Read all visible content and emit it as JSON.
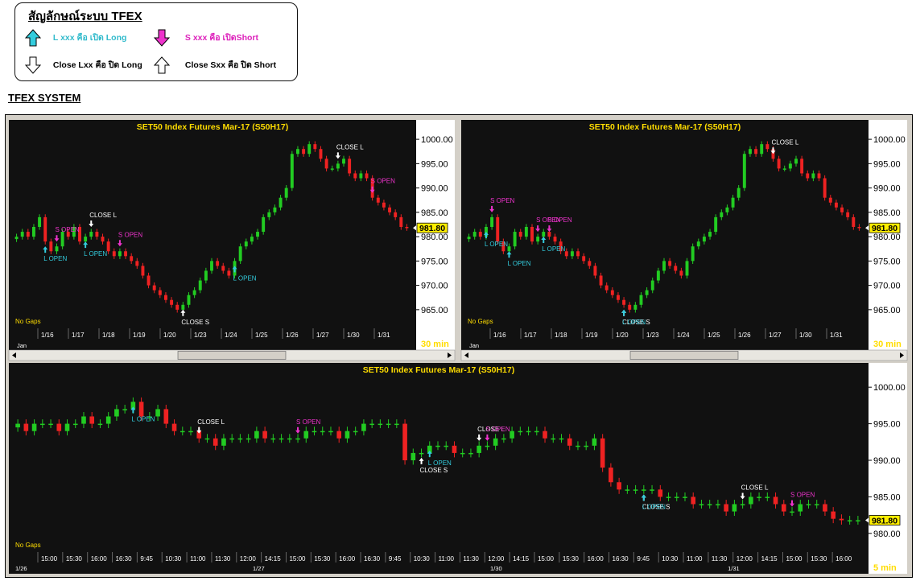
{
  "legend": {
    "title": "สัญลักษณ์ระบบ TFEX",
    "items": [
      {
        "label": "L xxx คือ เปิด Long",
        "icon": "arrow-up-filled-icon",
        "color": "#33ccdd"
      },
      {
        "label": "S xxx คือ เปิดShort",
        "icon": "arrow-down-filled-icon",
        "color": "#ee33cc"
      },
      {
        "label": "Close Lxx คือ ปิด Long",
        "icon": "arrow-down-outline-icon",
        "color": "#000000"
      },
      {
        "label": "Close Sxx คือ ปิด Short",
        "icon": "arrow-up-outline-icon",
        "color": "#000000"
      }
    ]
  },
  "section_title": "TFEX SYSTEM",
  "colors": {
    "up": "#22cc22",
    "down": "#ee2222",
    "long": "#33ccdd",
    "short": "#ee33cc",
    "close": "#ffffff",
    "title": "#ffdd00",
    "price_box": "#ffee00"
  },
  "chart_data": [
    {
      "type": "candlestick",
      "title": "SET50  Index  Futures  Mar-17  (S50H17)",
      "interval": "30  min",
      "note": "No Gaps",
      "last_price": "981.80",
      "ylim": [
        962,
        1002
      ],
      "yticks": [
        "1000.00",
        "995.00",
        "990.00",
        "985.00",
        "980.00",
        "975.00",
        "970.00",
        "965.00"
      ],
      "x_labels": [
        "1/16",
        "1/17",
        "1/18",
        "1/19",
        "1/20",
        "1/23",
        "1/24",
        "1/25",
        "1/26",
        "1/27",
        "1/30",
        "1/31"
      ],
      "period_label": "Jan",
      "closes": [
        980,
        981,
        980,
        982,
        984,
        979,
        977,
        978,
        981,
        980,
        982,
        979,
        980,
        981,
        980,
        979,
        977,
        976,
        977,
        976,
        975,
        974,
        972,
        970,
        969,
        968,
        967,
        966,
        965,
        966,
        968,
        969,
        971,
        973,
        975,
        974,
        973,
        972,
        975,
        978,
        979,
        980,
        981,
        984,
        985,
        986,
        988,
        990,
        997,
        998,
        997,
        999,
        998,
        996,
        994,
        994,
        995,
        996,
        993,
        992,
        993,
        992,
        988,
        987,
        986,
        985,
        984,
        982,
        981.8
      ],
      "markers": [
        {
          "i": 5,
          "kind": "long",
          "text": "L  OPEN"
        },
        {
          "i": 7,
          "kind": "short",
          "text": "S  OPEN"
        },
        {
          "i": 12,
          "kind": "long",
          "text": "L  OPEN"
        },
        {
          "i": 13,
          "kind": "close_long",
          "text": "CLOSE  L"
        },
        {
          "i": 18,
          "kind": "short",
          "text": "S  OPEN"
        },
        {
          "i": 29,
          "kind": "close_short",
          "text": "CLOSE  S"
        },
        {
          "i": 38,
          "kind": "long",
          "text": "L  OPEN"
        },
        {
          "i": 56,
          "kind": "close_long",
          "text": "CLOSE  L"
        },
        {
          "i": 62,
          "kind": "short",
          "text": "S  OPEN"
        }
      ]
    },
    {
      "type": "candlestick",
      "title": "SET50  Index  Futures  Mar-17  (S50H17)",
      "interval": "30  min",
      "note": "No Gaps",
      "last_price": "981.80",
      "ylim": [
        962,
        1002
      ],
      "yticks": [
        "1000.00",
        "995.00",
        "990.00",
        "985.00",
        "980.00",
        "975.00",
        "970.00",
        "965.00"
      ],
      "x_labels": [
        "1/16",
        "1/17",
        "1/18",
        "1/19",
        "1/20",
        "1/23",
        "1/24",
        "1/25",
        "1/26",
        "1/27",
        "1/30",
        "1/31"
      ],
      "period_label": "Jan",
      "closes": [
        980,
        981,
        980,
        982,
        984,
        979,
        977,
        978,
        981,
        980,
        982,
        979,
        980,
        981,
        980,
        979,
        977,
        976,
        977,
        976,
        975,
        974,
        972,
        970,
        969,
        968,
        967,
        966,
        965,
        966,
        968,
        969,
        971,
        973,
        975,
        974,
        973,
        972,
        975,
        978,
        979,
        980,
        981,
        984,
        985,
        986,
        988,
        990,
        997,
        998,
        997,
        999,
        998,
        996,
        994,
        994,
        995,
        996,
        993,
        992,
        993,
        992,
        988,
        987,
        986,
        985,
        984,
        982,
        981.8
      ],
      "markers": [
        {
          "i": 4,
          "kind": "short",
          "text": "S  OPEN"
        },
        {
          "i": 3,
          "kind": "long",
          "text": "L  OPEN"
        },
        {
          "i": 7,
          "kind": "long",
          "text": "L  OPEN"
        },
        {
          "i": 12,
          "kind": "short",
          "text": "S  OPEN"
        },
        {
          "i": 13,
          "kind": "long",
          "text": "L  OPEN"
        },
        {
          "i": 14,
          "kind": "short",
          "text": "S  OPEN"
        },
        {
          "i": 27,
          "kind": "close_short",
          "text": "CLOSE  S"
        },
        {
          "i": 27,
          "kind": "long",
          "text": "L  OPEN"
        },
        {
          "i": 53,
          "kind": "close_long",
          "text": "CLOSE  L"
        }
      ]
    },
    {
      "type": "candlestick",
      "title": "SET50  Index  Futures  Mar-17  (S50H17)",
      "interval": "5  min",
      "note": "No Gaps",
      "last_price": "981.80",
      "ylim": [
        978,
        1002
      ],
      "yticks": [
        "1000.00",
        "995.00",
        "990.00",
        "985.00",
        "980.00"
      ],
      "x_labels": [
        "15:00",
        "15:30",
        "16:00",
        "16:30",
        "9:45",
        "10:30",
        "11:00",
        "11:30",
        "12:00",
        "14:15",
        "15:00",
        "15:30",
        "16:00",
        "16:30",
        "9:45",
        "10:30",
        "11:00",
        "11:30",
        "12:00",
        "14:15",
        "15:00",
        "15:30",
        "16:00",
        "16:30",
        "9:45",
        "10:30",
        "11:00",
        "11:30",
        "12:00",
        "14:15",
        "15:00",
        "15:30",
        "16:00"
      ],
      "date_labels": [
        "1/26",
        "1/27",
        "1/30",
        "1/31"
      ],
      "closes": [
        995,
        994,
        995,
        995,
        995,
        994,
        995,
        995,
        996,
        995,
        995,
        996,
        997,
        997,
        998,
        996,
        996,
        997,
        995,
        994,
        994,
        994,
        993,
        993,
        992,
        993,
        993,
        993,
        993,
        994,
        993,
        993,
        993,
        993,
        993,
        994,
        994,
        994,
        994,
        993,
        994,
        994,
        995,
        995,
        995,
        995,
        995,
        990,
        991,
        991,
        992,
        992,
        992,
        991,
        991,
        991,
        992,
        992,
        993,
        993,
        994,
        994,
        994,
        994,
        993,
        993,
        993,
        992,
        992,
        992,
        993,
        989,
        987,
        986,
        986,
        986,
        986,
        986,
        985,
        985,
        985,
        985,
        984,
        984,
        984,
        984,
        983,
        984,
        984,
        985,
        985,
        985,
        984,
        983,
        983,
        984,
        984,
        984,
        983,
        982,
        981.8,
        981.8,
        981.8
      ],
      "markers": [
        {
          "i": 14,
          "kind": "long",
          "text": "L  OPEN"
        },
        {
          "i": 22,
          "kind": "close_long",
          "text": "CLOSE  L"
        },
        {
          "i": 34,
          "kind": "short",
          "text": "S  OPEN"
        },
        {
          "i": 49,
          "kind": "close_short",
          "text": "CLOSE  S"
        },
        {
          "i": 50,
          "kind": "long",
          "text": "L  OPEN"
        },
        {
          "i": 56,
          "kind": "close_long",
          "text": "CLOSE  L"
        },
        {
          "i": 57,
          "kind": "short",
          "text": "S  OPEN"
        },
        {
          "i": 76,
          "kind": "close_short",
          "text": "CLOSE  S"
        },
        {
          "i": 76,
          "kind": "long",
          "text": "L  OPEN"
        },
        {
          "i": 88,
          "kind": "close_long",
          "text": "CLOSE  L"
        },
        {
          "i": 94,
          "kind": "short",
          "text": "S  OPEN"
        }
      ]
    }
  ]
}
